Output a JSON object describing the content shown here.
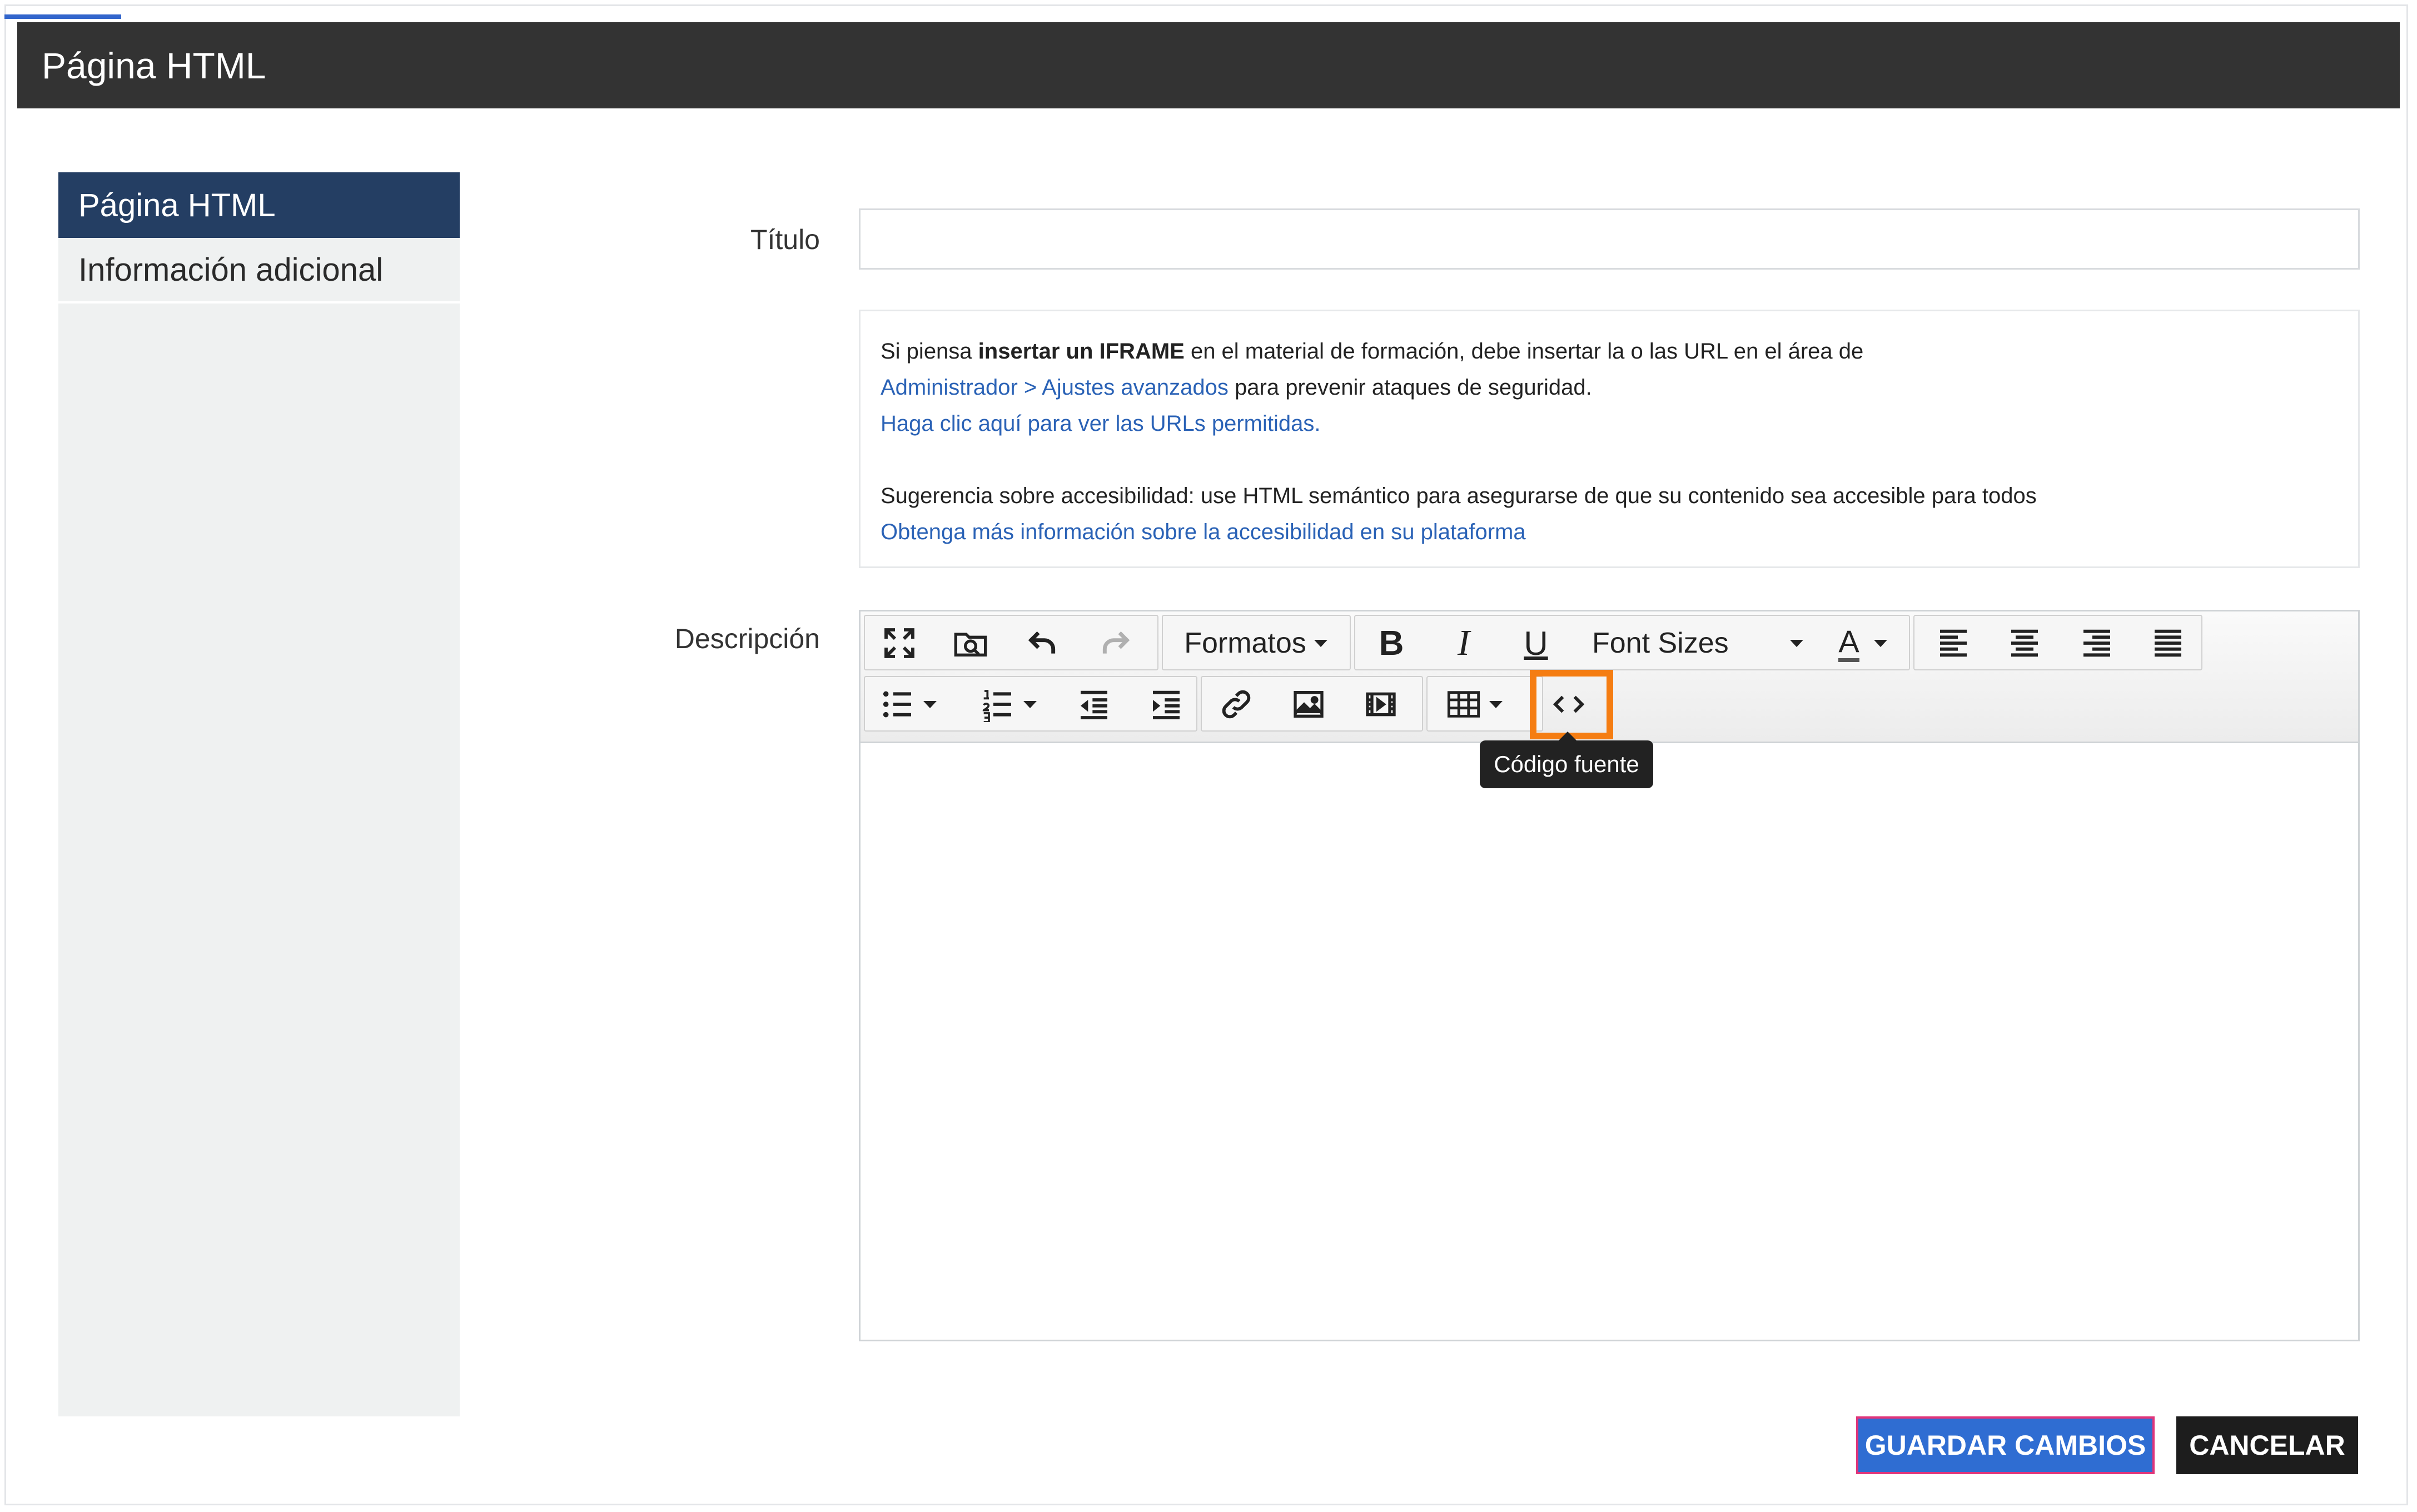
{
  "window": {
    "title": "Página HTML"
  },
  "sidebar": {
    "items": [
      {
        "label": "Página HTML",
        "active": true
      },
      {
        "label": "Información adicional",
        "active": false
      }
    ]
  },
  "form": {
    "title_label": "Título",
    "title_value": "",
    "description_label": "Descripción"
  },
  "info": {
    "line1_pre": "Si piensa ",
    "line1_bold": "insertar un IFRAME",
    "line1_post": " en el material de formación, debe insertar la o las URL en el área de",
    "line2_link": "Administrador > Ajustes avanzados",
    "line2_post": " para prevenir ataques de seguridad.",
    "line3_link": "Haga clic aquí para ver las URLs permitidas.",
    "line4": "Sugerencia sobre accesibilidad: use HTML semántico para asegurarse de que su contenido sea accesible para todos",
    "line5_link": "Obtenga más información sobre la accesibilidad en su plataforma"
  },
  "toolbar": {
    "formats_label": "Formatos",
    "font_sizes_label": "Font Sizes",
    "bold_glyph": "B",
    "italic_glyph": "I",
    "underline_glyph": "U",
    "text_color_glyph": "A",
    "source_code_glyph": "<>",
    "tooltip": "Código fuente"
  },
  "actions": {
    "save_label": "GUARDAR CAMBIOS",
    "cancel_label": "CANCELAR"
  },
  "colors": {
    "titlebar": "#333333",
    "sidebar_active": "#243e63",
    "link": "#2a62b6",
    "save_button": "#2f6dd2",
    "highlight": "#f57d12"
  }
}
